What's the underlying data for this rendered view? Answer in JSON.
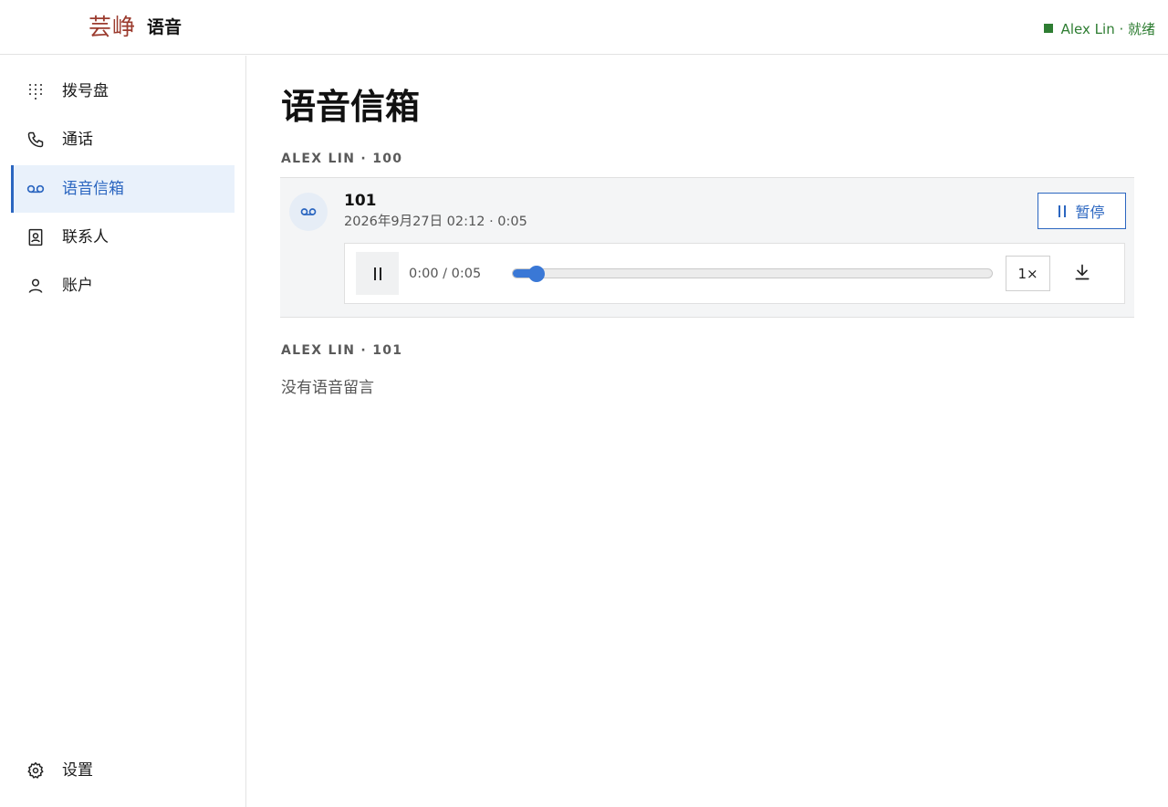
{
  "header": {
    "logo_text": "芸峥",
    "app_name": "语音",
    "status_text": "Alex Lin · 就绪",
    "status_color": "#2e7d32"
  },
  "sidebar": {
    "items": [
      {
        "label": "拨号盘",
        "icon": "dialpad-icon"
      },
      {
        "label": "通话",
        "icon": "phone-icon"
      },
      {
        "label": "语音信箱",
        "icon": "voicemail-icon",
        "active": true
      },
      {
        "label": "联系人",
        "icon": "contact-book-icon"
      },
      {
        "label": "账户",
        "icon": "person-icon"
      }
    ],
    "settings": {
      "label": "设置",
      "icon": "gear-icon"
    }
  },
  "main": {
    "title": "语音信箱",
    "mailboxes": [
      {
        "label": "ALEX LIN · 100",
        "messages": [
          {
            "from": "101",
            "meta": "2026年9月27日 02:12 · 0:05",
            "pause_label": "暂停",
            "player": {
              "time": "0:00 / 0:05",
              "progress": 0.05,
              "speed": "1×"
            }
          }
        ]
      },
      {
        "label": "ALEX LIN · 101",
        "empty_text": "没有语音留言"
      }
    ]
  },
  "colors": {
    "accent": "#2b66c0",
    "active_bg": "#e9f1fb",
    "logo": "#9b3b2e"
  }
}
